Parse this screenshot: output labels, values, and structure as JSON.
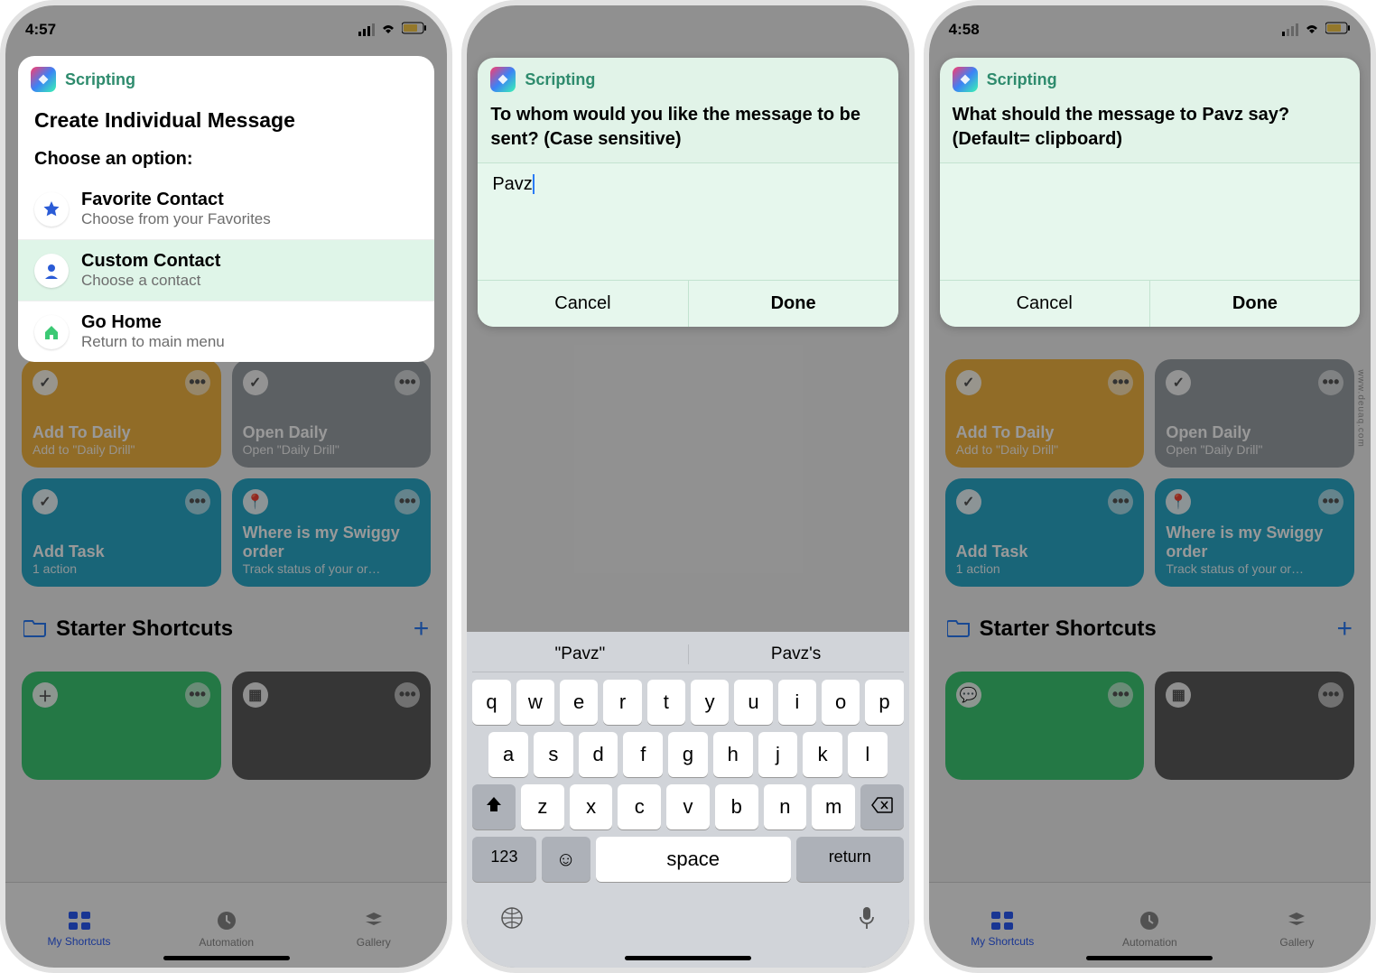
{
  "status": {
    "time_a": "4:57",
    "time_c": "4:58"
  },
  "scripting_label": "Scripting",
  "menu": {
    "title": "Create Individual Message",
    "subtitle": "Choose an option:",
    "options": [
      {
        "title": "Favorite Contact",
        "sub": "Choose from your Favorites"
      },
      {
        "title": "Custom Contact",
        "sub": "Choose a contact"
      },
      {
        "title": "Go Home",
        "sub": "Return to main menu"
      }
    ]
  },
  "dialog2": {
    "prompt": "To whom would you like the message to be sent? (Case sensitive)",
    "input_value": "Pavz",
    "cancel": "Cancel",
    "done": "Done"
  },
  "dialog3": {
    "prompt": "What should the message to Pavz say? (Default= clipboard)",
    "input_value": "",
    "cancel": "Cancel",
    "done": "Done"
  },
  "tiles": {
    "add_daily": {
      "title": "Add To Daily",
      "sub": "Add to \"Daily Drill\""
    },
    "open_daily": {
      "title": "Open Daily",
      "sub": "Open \"Daily Drill\""
    },
    "add_task": {
      "title": "Add Task",
      "sub": "1 action"
    },
    "swiggy": {
      "title": "Where is my Swiggy order",
      "sub": "Track status of your or…"
    }
  },
  "section": {
    "title": "Starter Shortcuts"
  },
  "tabs": {
    "my": "My Shortcuts",
    "auto": "Automation",
    "gallery": "Gallery"
  },
  "keyboard": {
    "suggestions": [
      "\"Pavz\"",
      "Pavz's"
    ],
    "row1": [
      "q",
      "w",
      "e",
      "r",
      "t",
      "y",
      "u",
      "i",
      "o",
      "p"
    ],
    "row2": [
      "a",
      "s",
      "d",
      "f",
      "g",
      "h",
      "j",
      "k",
      "l"
    ],
    "row3": [
      "z",
      "x",
      "c",
      "v",
      "b",
      "n",
      "m"
    ],
    "num": "123",
    "space": "space",
    "return": "return"
  },
  "watermark": "www.deuaq.com"
}
